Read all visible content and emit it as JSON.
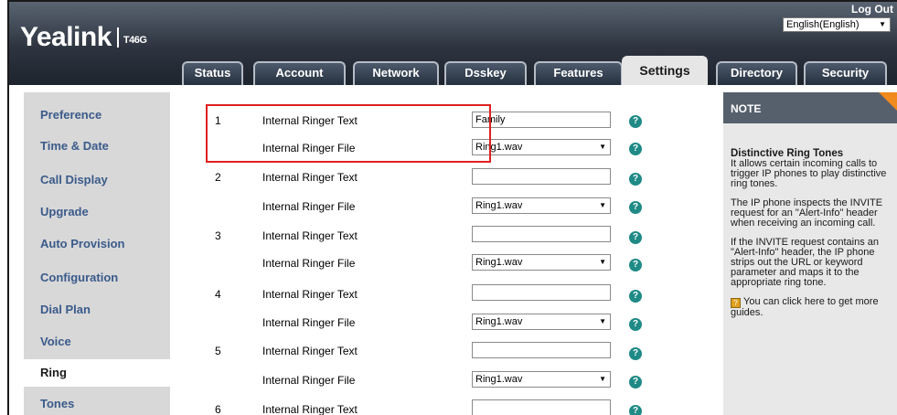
{
  "brand": {
    "logo": "Yealink",
    "model": "T46G"
  },
  "header": {
    "logout": "Log Out",
    "language": "English(English)"
  },
  "tabs": [
    "Status",
    "Account",
    "Network",
    "Dsskey",
    "Features",
    "Settings",
    "Directory",
    "Security"
  ],
  "active_tab": "Settings",
  "sidebar": {
    "items": [
      "Preference",
      "Time & Date",
      "Call Display",
      "Upgrade",
      "Auto Provision",
      "Configuration",
      "Dial Plan",
      "Voice",
      "Ring",
      "Tones"
    ],
    "active": "Ring"
  },
  "ring_rows": [
    {
      "num": "1",
      "text_label": "Internal Ringer Text",
      "text_value": "Family",
      "file_label": "Internal Ringer File",
      "file_value": "Ring1.wav"
    },
    {
      "num": "2",
      "text_label": "Internal Ringer Text",
      "text_value": "",
      "file_label": "Internal Ringer File",
      "file_value": "Ring1.wav"
    },
    {
      "num": "3",
      "text_label": "Internal Ringer Text",
      "text_value": "",
      "file_label": "Internal Ringer File",
      "file_value": "Ring1.wav"
    },
    {
      "num": "4",
      "text_label": "Internal Ringer Text",
      "text_value": "",
      "file_label": "Internal Ringer File",
      "file_value": "Ring1.wav"
    },
    {
      "num": "5",
      "text_label": "Internal Ringer Text",
      "text_value": "",
      "file_label": "Internal Ringer File",
      "file_value": "Ring1.wav"
    },
    {
      "num": "6",
      "text_label": "Internal Ringer Text",
      "text_value": ""
    }
  ],
  "note": {
    "title": "NOTE",
    "heading": "Distinctive Ring Tones",
    "p1": "It allows certain incoming calls to trigger IP phones to play distinctive ring tones.",
    "p2": "The IP phone inspects the INVITE request for an \"Alert-Info\" header when receiving an incoming call.",
    "p3": "If the INVITE request contains an \"Alert-Info\" header, the IP phone strips out the URL or keyword parameter and maps it to the appropriate ring tone.",
    "p4": "You can click here to get more guides."
  },
  "colors": {
    "highlight_box": "#e02020",
    "help_icon": "#1f8a86",
    "note_corner": "#f08a1c"
  }
}
